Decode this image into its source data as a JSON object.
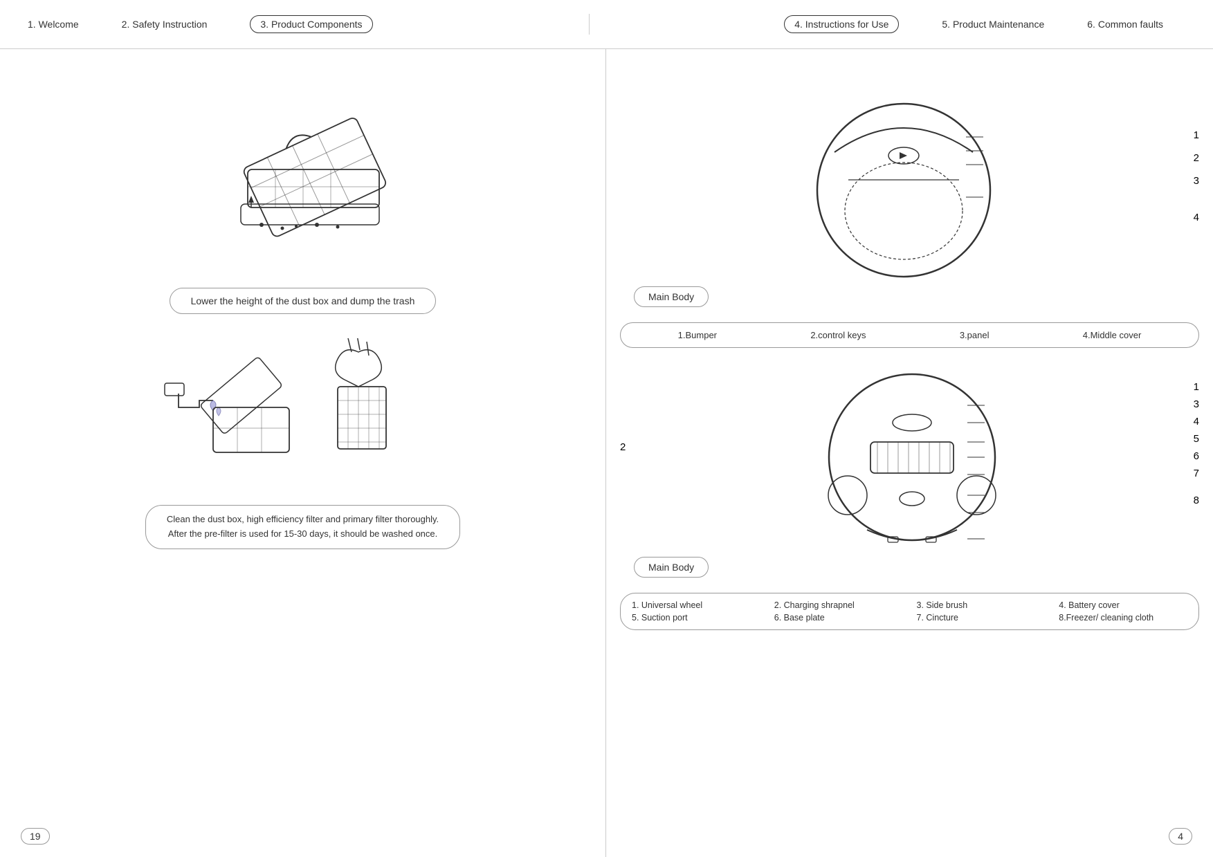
{
  "nav": {
    "items": [
      {
        "label": "1. Welcome",
        "active": false
      },
      {
        "label": "2. Safety Instruction",
        "active": false
      },
      {
        "label": "3. Product Components",
        "active": true
      },
      {
        "label": "4. Instructions for Use",
        "active": true
      },
      {
        "label": "5. Product Maintenance",
        "active": false
      },
      {
        "label": "6. Common faults",
        "active": false
      }
    ]
  },
  "left_page": {
    "page_number": "19",
    "caption1": "Lower the height of the dust box and dump the trash",
    "caption2_line1": "Clean the dust box, high efficiency filter and primary filter thoroughly.",
    "caption2_line2": "After the pre-filter is used for 15-30 days, it should be washed once."
  },
  "right_page": {
    "page_number": "4",
    "main_body_label": "Main Body",
    "parts_top": [
      {
        "label": "1.Bumper"
      },
      {
        "label": "2.control keys"
      },
      {
        "label": "3.panel"
      },
      {
        "label": "4.Middle cover"
      }
    ],
    "numbers_top": [
      "1",
      "2",
      "3",
      "4"
    ],
    "main_body_label2": "Main Body",
    "numbers_bottom": [
      "1",
      "2",
      "3",
      "4",
      "5",
      "6",
      "7",
      "8"
    ],
    "parts_bottom": [
      "1. Universal wheel",
      "2. Charging shrapnel",
      "3. Side brush",
      "4. Battery cover",
      "5. Suction port",
      "6. Base plate",
      "7. Cincture",
      "8.Freezer/ cleaning cloth"
    ]
  }
}
